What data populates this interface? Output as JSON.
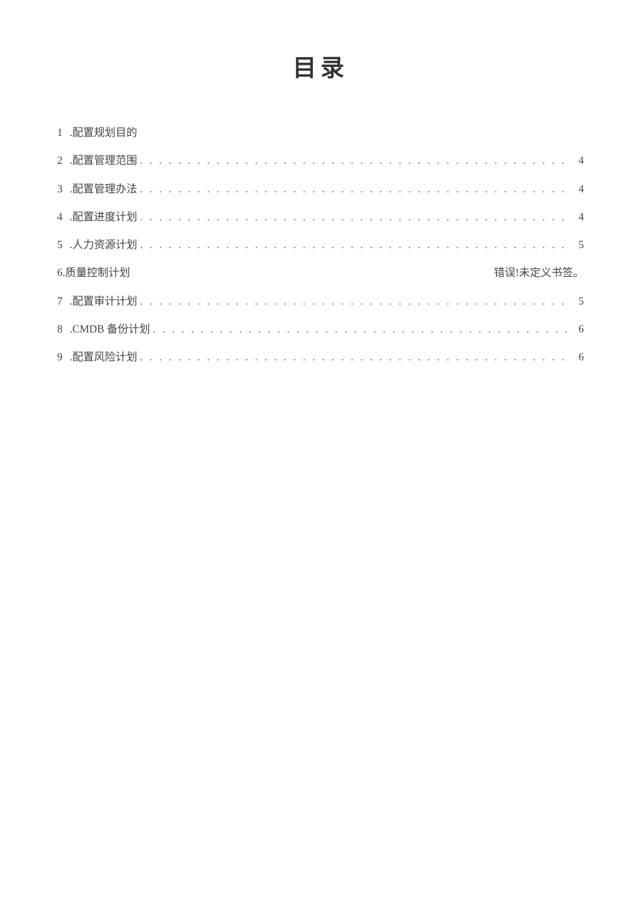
{
  "title": "目录",
  "toc": {
    "entries": [
      {
        "num": "1 ",
        "label": ".配置规划目的",
        "page": "",
        "style": "nopagedots"
      },
      {
        "num": "2  ",
        "label": ".配置管理范围",
        "page": "4",
        "style": "dots"
      },
      {
        "num": "3  ",
        "label": ".配置管理办法",
        "page": "4",
        "style": "dots"
      },
      {
        "num": "4  ",
        "label": ".配置进度计划",
        "page": "4",
        "style": "dots"
      },
      {
        "num": "5  ",
        "label": ".人力资源计划",
        "page": "5",
        "style": "dots"
      },
      {
        "num": "6.",
        "label": "质量控制计划",
        "page": "错误!未定义书签。",
        "style": "error"
      },
      {
        "num": "7  ",
        "label": ".配置审计计划",
        "page": "5",
        "style": "dots"
      },
      {
        "num": "8  ",
        "label": ".CMDB 备份计划",
        "page": "6",
        "style": "dots"
      },
      {
        "num": "9  ",
        "label": ".配置风险计划",
        "page": "6",
        "style": "dots"
      }
    ]
  }
}
